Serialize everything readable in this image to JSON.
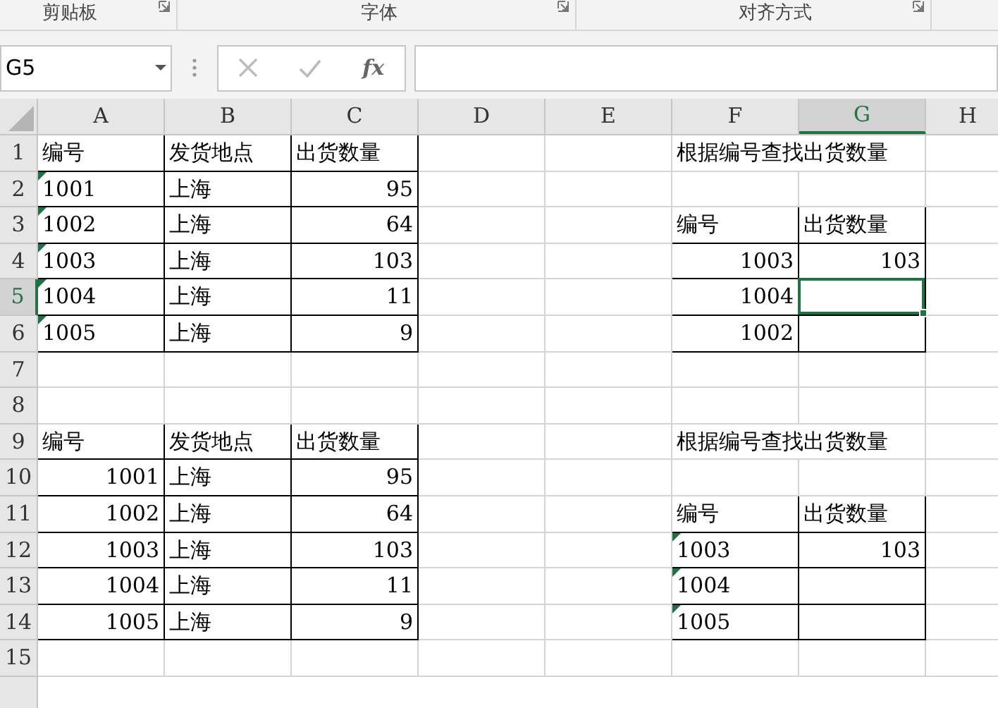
{
  "ribbon_groups": [
    {
      "label": "剪贴板"
    },
    {
      "label": "字体"
    },
    {
      "label": "对齐方式"
    }
  ],
  "formula_bar": {
    "name_box": "G5",
    "function_button": "fx"
  },
  "columns": [
    {
      "label": "A",
      "selected": false
    },
    {
      "label": "B",
      "selected": false
    },
    {
      "label": "C",
      "selected": false
    },
    {
      "label": "D",
      "selected": false
    },
    {
      "label": "E",
      "selected": false
    },
    {
      "label": "F",
      "selected": false
    },
    {
      "label": "G",
      "selected": true
    },
    {
      "label": "H",
      "selected": false
    }
  ],
  "rows": [
    {
      "label": "1",
      "selected": false,
      "cells": [
        {
          "kind": "text",
          "text": "编号",
          "boxed": true
        },
        {
          "kind": "text",
          "text": "发货地点",
          "boxed": true
        },
        {
          "kind": "text",
          "text": "出货数量",
          "boxed": true
        },
        {
          "kind": "empty"
        },
        {
          "kind": "empty"
        },
        {
          "kind": "wide",
          "text": "根据编号查找出货数量"
        },
        {
          "kind": "empty"
        },
        {
          "kind": "empty"
        }
      ]
    },
    {
      "label": "2",
      "selected": false,
      "cells": [
        {
          "kind": "textnum",
          "text": "1001",
          "boxed": true
        },
        {
          "kind": "text",
          "text": "上海",
          "boxed": true
        },
        {
          "kind": "number",
          "text": "95",
          "boxed": true
        },
        {
          "kind": "empty"
        },
        {
          "kind": "empty"
        },
        {
          "kind": "empty"
        },
        {
          "kind": "empty"
        },
        {
          "kind": "empty"
        }
      ]
    },
    {
      "label": "3",
      "selected": false,
      "cells": [
        {
          "kind": "textnum",
          "text": "1002",
          "boxed": true
        },
        {
          "kind": "text",
          "text": "上海",
          "boxed": true
        },
        {
          "kind": "number",
          "text": "64",
          "boxed": true
        },
        {
          "kind": "empty"
        },
        {
          "kind": "empty"
        },
        {
          "kind": "text",
          "text": "编号",
          "boxed": true
        },
        {
          "kind": "text",
          "text": "出货数量",
          "boxed": true
        },
        {
          "kind": "empty"
        }
      ]
    },
    {
      "label": "4",
      "selected": false,
      "cells": [
        {
          "kind": "textnum",
          "text": "1003",
          "boxed": true
        },
        {
          "kind": "text",
          "text": "上海",
          "boxed": true
        },
        {
          "kind": "number",
          "text": "103",
          "boxed": true
        },
        {
          "kind": "empty"
        },
        {
          "kind": "empty"
        },
        {
          "kind": "number",
          "text": "1003",
          "boxed": true
        },
        {
          "kind": "number",
          "text": "103",
          "boxed": true
        },
        {
          "kind": "empty"
        }
      ]
    },
    {
      "label": "5",
      "selected": true,
      "cells": [
        {
          "kind": "textnum",
          "text": "1004",
          "boxed": true
        },
        {
          "kind": "text",
          "text": "上海",
          "boxed": true
        },
        {
          "kind": "number",
          "text": "11",
          "boxed": true
        },
        {
          "kind": "empty"
        },
        {
          "kind": "empty"
        },
        {
          "kind": "number",
          "text": "1004",
          "boxed": true
        },
        {
          "kind": "empty",
          "boxed": true
        },
        {
          "kind": "empty"
        }
      ]
    },
    {
      "label": "6",
      "selected": false,
      "cells": [
        {
          "kind": "textnum",
          "text": "1005",
          "boxed": true
        },
        {
          "kind": "text",
          "text": "上海",
          "boxed": true
        },
        {
          "kind": "number",
          "text": "9",
          "boxed": true
        },
        {
          "kind": "empty"
        },
        {
          "kind": "empty"
        },
        {
          "kind": "number",
          "text": "1002",
          "boxed": true
        },
        {
          "kind": "empty",
          "boxed": true
        },
        {
          "kind": "empty"
        }
      ]
    },
    {
      "label": "7",
      "selected": false,
      "cells": [
        {
          "kind": "empty"
        },
        {
          "kind": "empty"
        },
        {
          "kind": "empty"
        },
        {
          "kind": "empty"
        },
        {
          "kind": "empty"
        },
        {
          "kind": "empty"
        },
        {
          "kind": "empty"
        },
        {
          "kind": "empty"
        }
      ]
    },
    {
      "label": "8",
      "selected": false,
      "cells": [
        {
          "kind": "empty"
        },
        {
          "kind": "empty"
        },
        {
          "kind": "empty"
        },
        {
          "kind": "empty"
        },
        {
          "kind": "empty"
        },
        {
          "kind": "empty"
        },
        {
          "kind": "empty"
        },
        {
          "kind": "empty"
        }
      ]
    },
    {
      "label": "9",
      "selected": false,
      "cells": [
        {
          "kind": "text",
          "text": "编号",
          "boxed": true
        },
        {
          "kind": "text",
          "text": "发货地点",
          "boxed": true
        },
        {
          "kind": "text",
          "text": "出货数量",
          "boxed": true
        },
        {
          "kind": "empty"
        },
        {
          "kind": "empty"
        },
        {
          "kind": "wide",
          "text": "根据编号查找出货数量"
        },
        {
          "kind": "empty"
        },
        {
          "kind": "empty"
        }
      ]
    },
    {
      "label": "10",
      "selected": false,
      "cells": [
        {
          "kind": "number",
          "text": "1001",
          "boxed": true
        },
        {
          "kind": "text",
          "text": "上海",
          "boxed": true
        },
        {
          "kind": "number",
          "text": "95",
          "boxed": true
        },
        {
          "kind": "empty"
        },
        {
          "kind": "empty"
        },
        {
          "kind": "empty"
        },
        {
          "kind": "empty"
        },
        {
          "kind": "empty"
        }
      ]
    },
    {
      "label": "11",
      "selected": false,
      "cells": [
        {
          "kind": "number",
          "text": "1002",
          "boxed": true
        },
        {
          "kind": "text",
          "text": "上海",
          "boxed": true
        },
        {
          "kind": "number",
          "text": "64",
          "boxed": true
        },
        {
          "kind": "empty"
        },
        {
          "kind": "empty"
        },
        {
          "kind": "text",
          "text": "编号",
          "boxed": true
        },
        {
          "kind": "text",
          "text": "出货数量",
          "boxed": true
        },
        {
          "kind": "empty"
        }
      ]
    },
    {
      "label": "12",
      "selected": false,
      "cells": [
        {
          "kind": "number",
          "text": "1003",
          "boxed": true
        },
        {
          "kind": "text",
          "text": "上海",
          "boxed": true
        },
        {
          "kind": "number",
          "text": "103",
          "boxed": true
        },
        {
          "kind": "empty"
        },
        {
          "kind": "empty"
        },
        {
          "kind": "textnum",
          "text": "1003",
          "boxed": true
        },
        {
          "kind": "number",
          "text": "103",
          "boxed": true
        },
        {
          "kind": "empty"
        }
      ]
    },
    {
      "label": "13",
      "selected": false,
      "cells": [
        {
          "kind": "number",
          "text": "1004",
          "boxed": true
        },
        {
          "kind": "text",
          "text": "上海",
          "boxed": true
        },
        {
          "kind": "number",
          "text": "11",
          "boxed": true
        },
        {
          "kind": "empty"
        },
        {
          "kind": "empty"
        },
        {
          "kind": "textnum",
          "text": "1004",
          "boxed": true
        },
        {
          "kind": "empty",
          "boxed": true
        },
        {
          "kind": "empty"
        }
      ]
    },
    {
      "label": "14",
      "selected": false,
      "cells": [
        {
          "kind": "number",
          "text": "1005",
          "boxed": true
        },
        {
          "kind": "text",
          "text": "上海",
          "boxed": true
        },
        {
          "kind": "number",
          "text": "9",
          "boxed": true
        },
        {
          "kind": "empty"
        },
        {
          "kind": "empty"
        },
        {
          "kind": "textnum",
          "text": "1005",
          "boxed": true
        },
        {
          "kind": "empty",
          "boxed": true
        },
        {
          "kind": "empty"
        }
      ]
    },
    {
      "label": "15",
      "selected": false,
      "cells": [
        {
          "kind": "empty"
        },
        {
          "kind": "empty"
        },
        {
          "kind": "empty"
        },
        {
          "kind": "empty"
        },
        {
          "kind": "empty"
        },
        {
          "kind": "empty"
        },
        {
          "kind": "empty"
        },
        {
          "kind": "empty"
        }
      ]
    }
  ]
}
